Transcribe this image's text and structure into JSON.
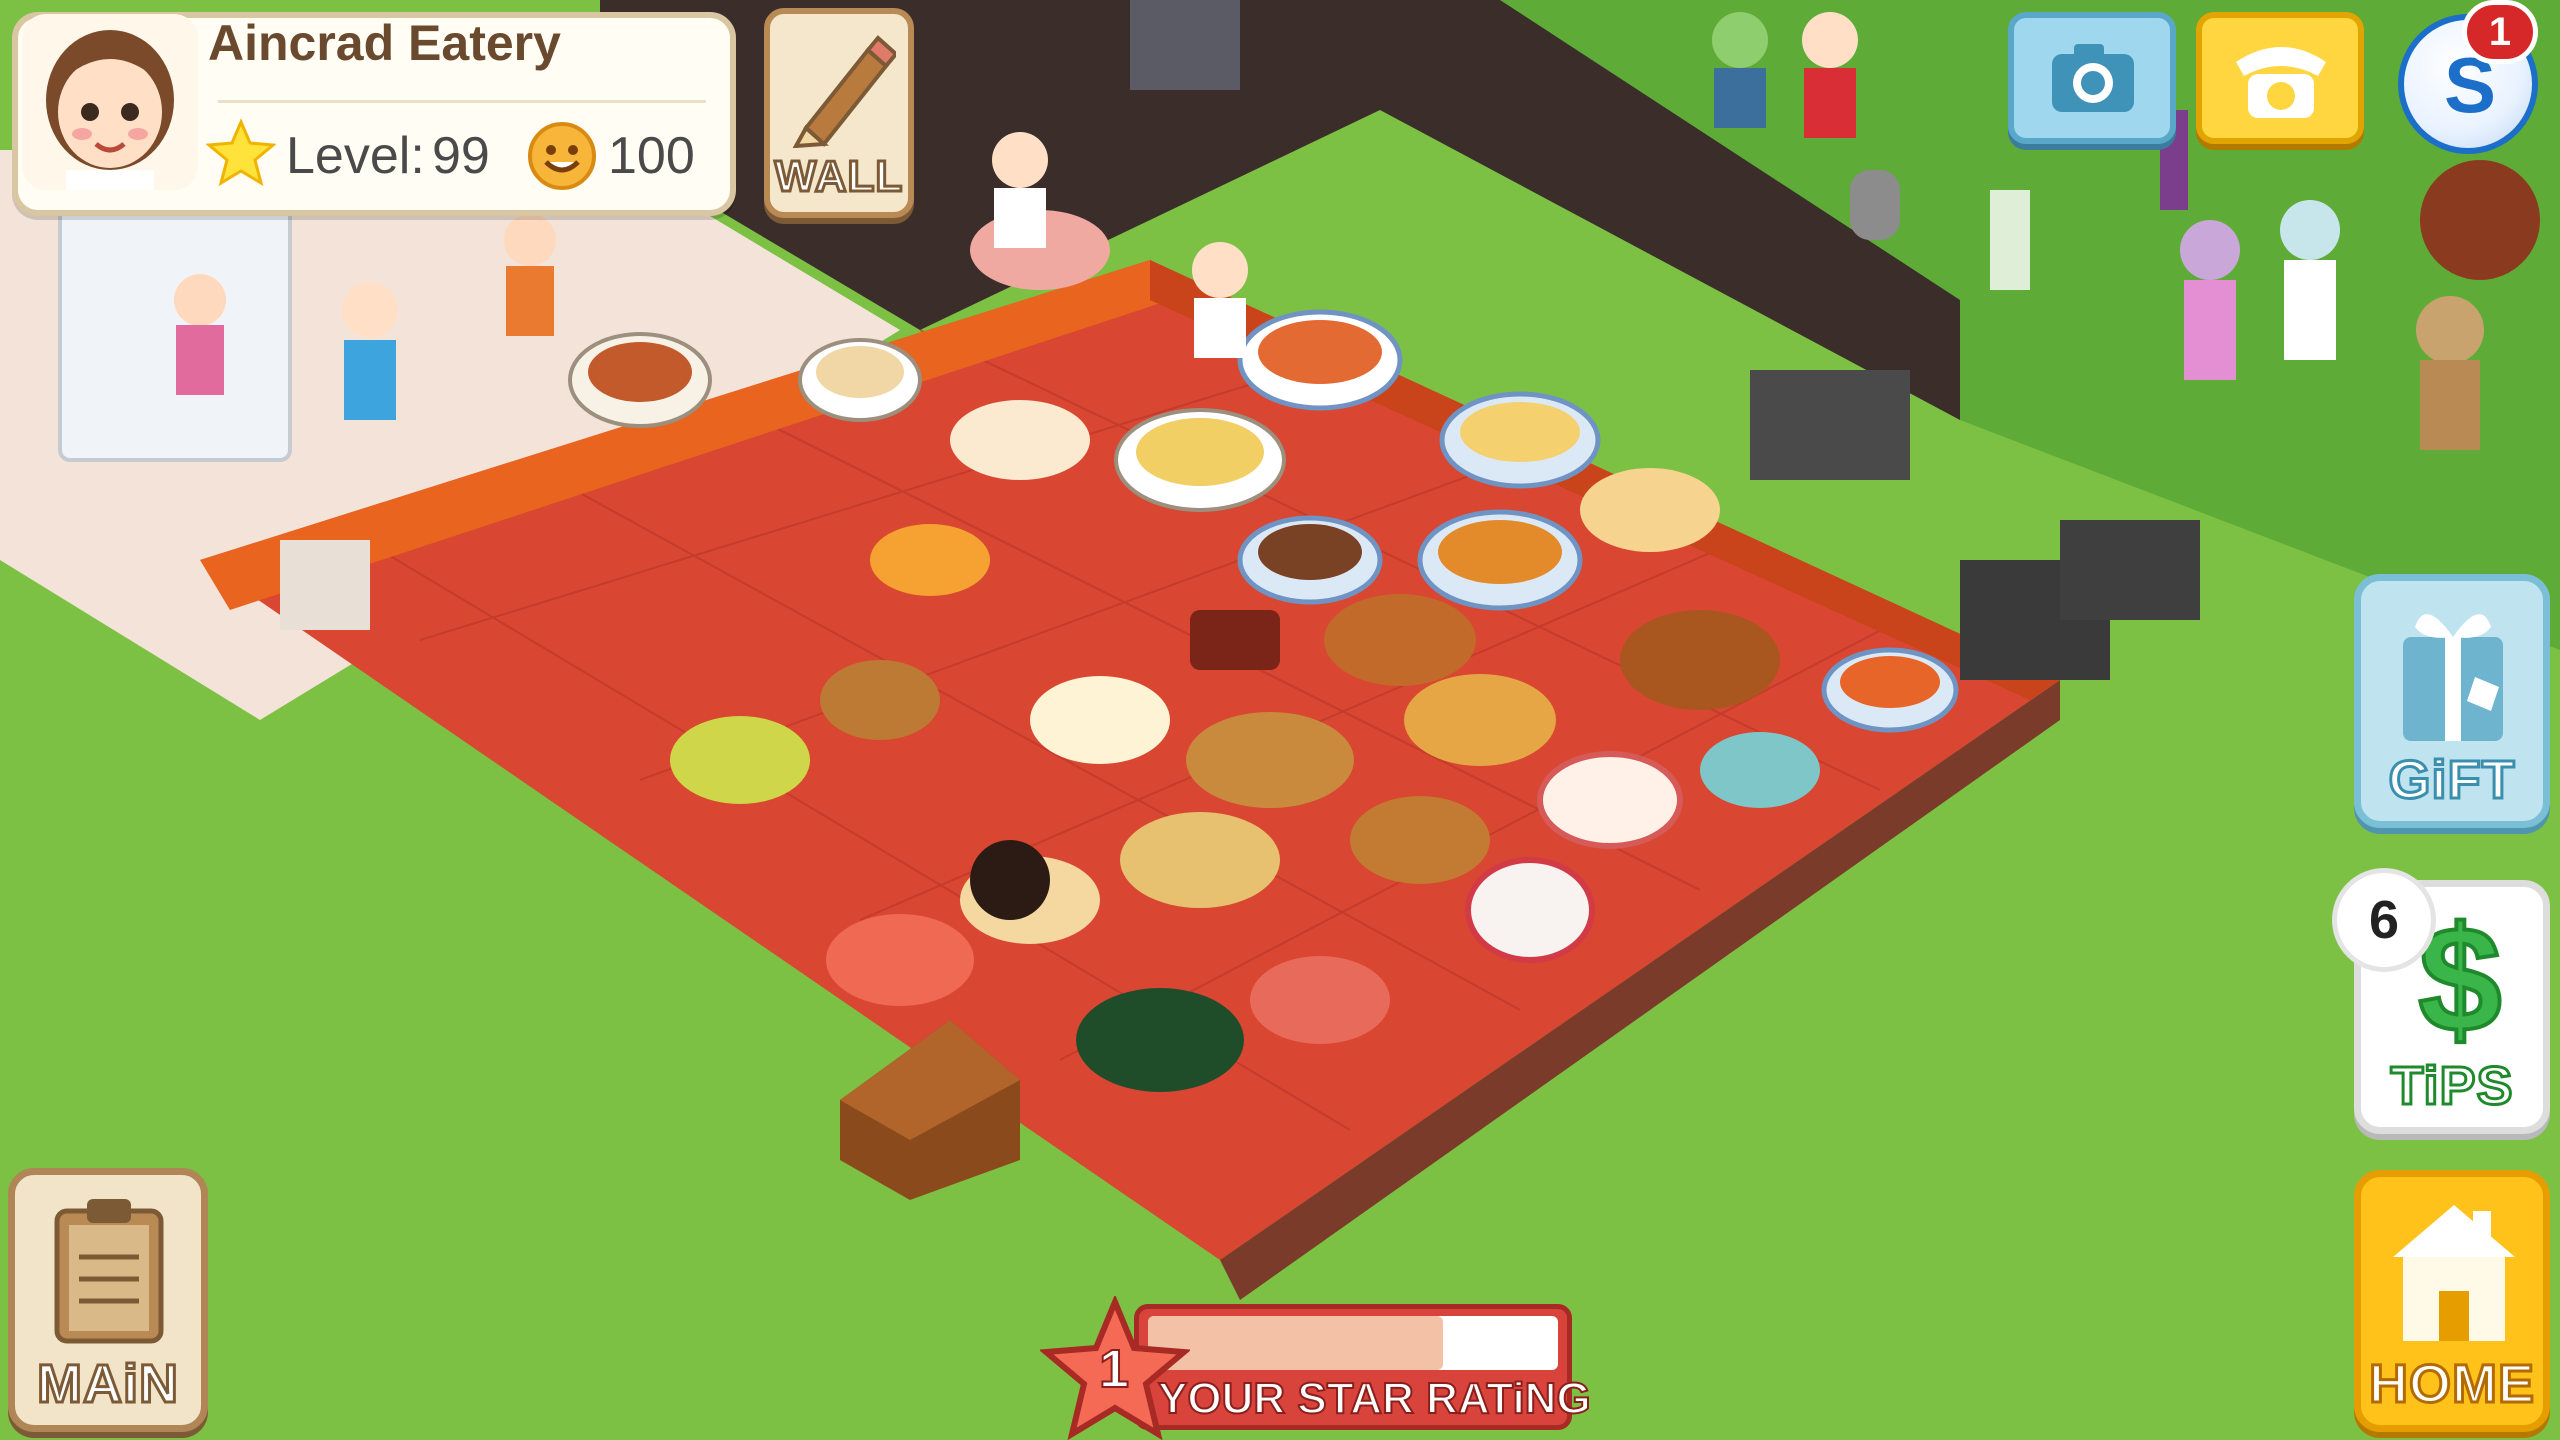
{
  "player": {
    "restaurant_name": "Aincrad Eatery",
    "level_label": "Level:",
    "level": "99",
    "coins": "100",
    "avatar_icon": "chef-girl-avatar"
  },
  "buttons": {
    "wall": "WALL",
    "gift": "GiFT",
    "tips": "TiPS",
    "home": "HOME",
    "main": "MAiN",
    "camera_icon": "camera-icon",
    "phone_icon": "phone-icon",
    "social_icon": "social-s-icon"
  },
  "badges": {
    "social_notifications": "1",
    "tips_count": "6"
  },
  "star_rating": {
    "label": "YOUR STAR RATiNG",
    "stars": "1",
    "progress": 0.72
  },
  "colors": {
    "grass": "#7cc144",
    "floor": "#d94631",
    "accent_orange": "#ffc21a",
    "rating_red": "#d8433c"
  }
}
